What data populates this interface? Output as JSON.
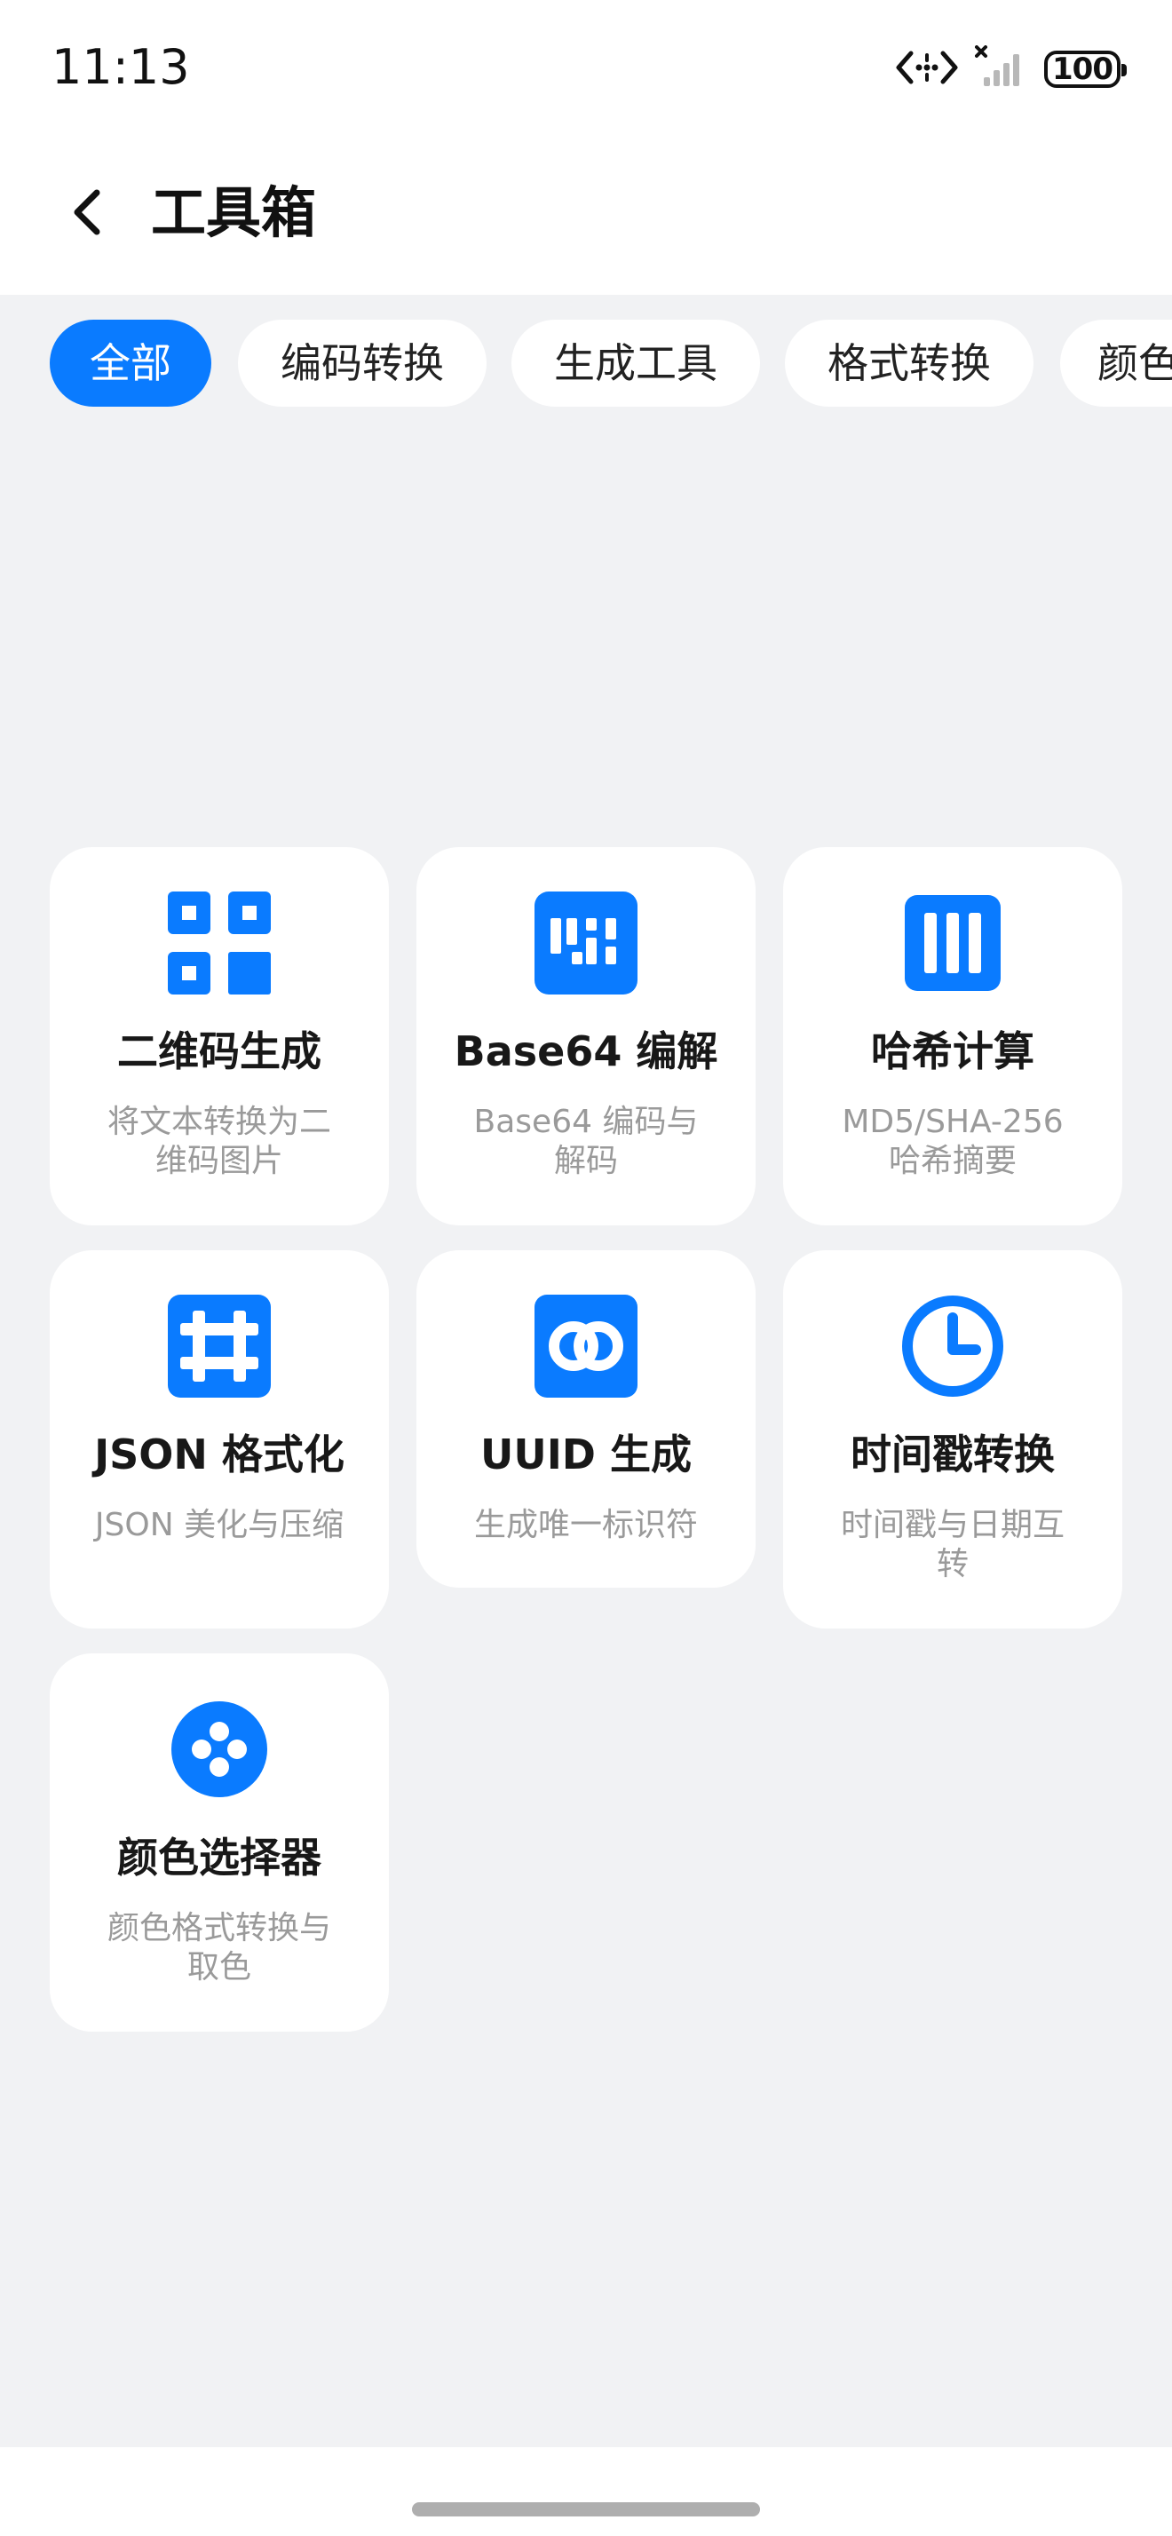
{
  "status": {
    "time": "11:13",
    "battery": "100"
  },
  "header": {
    "title": "工具箱"
  },
  "tabs": [
    {
      "label": "全部",
      "active": true
    },
    {
      "label": "编码转换",
      "active": false
    },
    {
      "label": "生成工具",
      "active": false
    },
    {
      "label": "格式转换",
      "active": false
    },
    {
      "label": "颜色",
      "active": false
    }
  ],
  "tools": [
    {
      "title": "二维码生成",
      "desc": "将文本转换为二维码图片",
      "icon": "qr-code-icon"
    },
    {
      "title": "Base64 编解",
      "desc": "Base64 编码与解码",
      "icon": "base64-icon"
    },
    {
      "title": "哈希计算",
      "desc": "MD5/SHA-256哈希摘要",
      "icon": "hash-icon"
    },
    {
      "title": "JSON 格式化",
      "desc": "JSON 美化与压缩",
      "icon": "grid-hash-icon"
    },
    {
      "title": "UUID 生成",
      "desc": "生成唯一标识符",
      "icon": "uuid-icon"
    },
    {
      "title": "时间戳转换",
      "desc": "时间戳与日期互转",
      "icon": "clock-icon"
    },
    {
      "title": "颜色选择器",
      "desc": "颜色格式转换与取色",
      "icon": "palette-icon"
    }
  ],
  "colors": {
    "accent": "#0a7bff",
    "background": "#f1f2f4",
    "card": "#ffffff"
  }
}
